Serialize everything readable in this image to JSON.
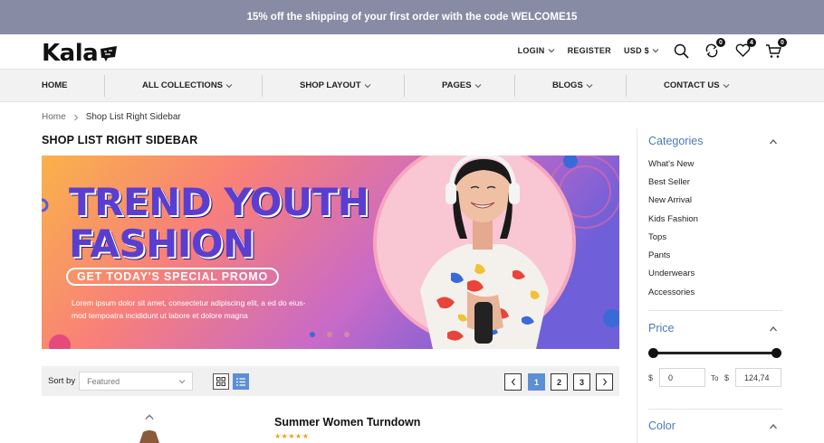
{
  "promo": {
    "text": "15% off the shipping of your first order with the code WELCOME15"
  },
  "brand": {
    "logo_text": "Kala"
  },
  "header": {
    "login": "LOGIN",
    "register": "REGISTER",
    "currency": "USD $",
    "compare_count": "0",
    "wishlist_count": "4",
    "cart_count": "0"
  },
  "nav": {
    "items": [
      {
        "label": "HOME"
      },
      {
        "label": "ALL COLLECTIONS"
      },
      {
        "label": "SHOP LAYOUT"
      },
      {
        "label": "PAGES"
      },
      {
        "label": "BLOGS"
      },
      {
        "label": "CONTACT US"
      }
    ]
  },
  "breadcrumb": {
    "home": "Home",
    "current": "Shop List Right Sidebar"
  },
  "page": {
    "title": "SHOP LIST RIGHT SIDEBAR"
  },
  "banner": {
    "headline_1": "TREND YOUTH",
    "headline_2": "FASHION",
    "promo": "GET TODAY'S SPECIAL PROMO",
    "body_1": "Lorem ipsum dolor sit amet, consectetur adipiscing elit, a ed do eius-",
    "body_2": "mod tempoatra incididunt ut labore et dolore magna"
  },
  "toolbar": {
    "sort_label": "Sort by",
    "sort_value": "Featured",
    "pages": [
      "1",
      "2",
      "3"
    ]
  },
  "product": {
    "title": "Summer Women Turndown",
    "rating": 5,
    "stars": "★★★★★"
  },
  "sidebar": {
    "categories_title": "Categories",
    "categories": [
      "What's New",
      "Best Seller",
      "New Arrival",
      "Kids Fashion",
      "Tops",
      "Pants",
      "Underwears",
      "Accessories"
    ],
    "price_title": "Price",
    "price_currency": "$",
    "price_min": "0",
    "price_to": "To",
    "price_max": "124,74",
    "color_title": "Color"
  },
  "colors": {
    "topbar": "#878ba3",
    "accent": "#4a78c0",
    "active_page": "#5b8fd6"
  }
}
